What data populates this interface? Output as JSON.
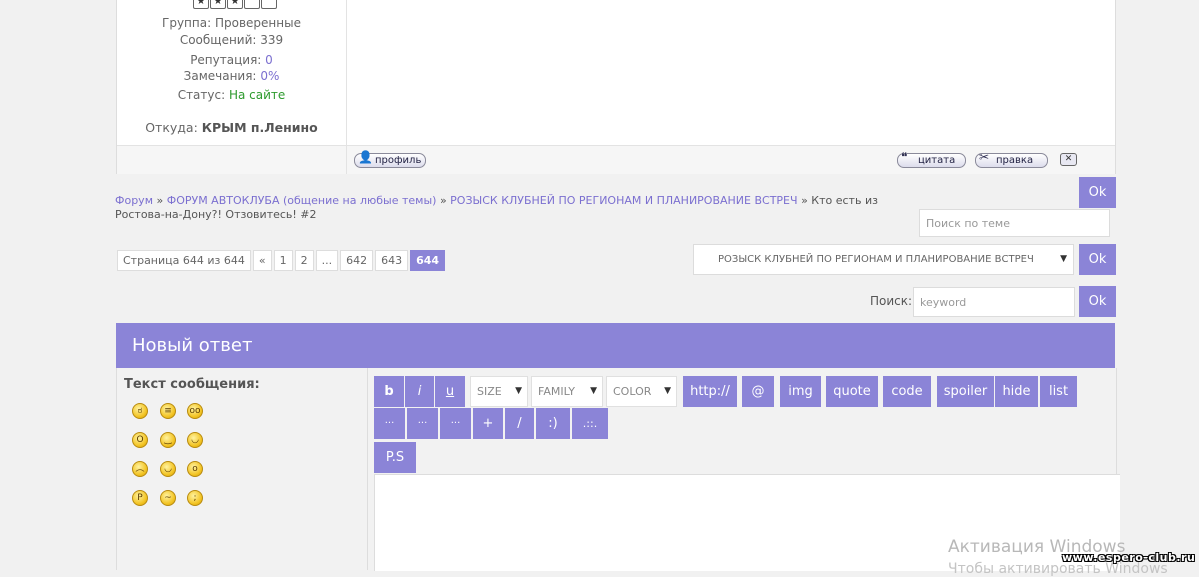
{
  "post": {
    "rating_stars": [
      "★",
      "★",
      "★",
      "",
      ""
    ],
    "group_label": "Группа:",
    "group_value": "Проверенные",
    "messages_label": "Сообщений:",
    "messages_value": "339",
    "reputation_label": "Репутация:",
    "reputation_value": "0",
    "warnings_label": "Замечания:",
    "warnings_value": "0%",
    "status_label": "Статус:",
    "status_value": "На сайте",
    "from_label": "Откуда:",
    "from_value": "КРЫМ п.Ленино",
    "profile_btn": "профиль",
    "quote_btn": "цитата",
    "edit_btn": "правка",
    "delete_btn": "✕"
  },
  "breadcrumb": {
    "items": [
      "Форум",
      "ФОРУМ АВТОКЛУБА (общение на любые темы)",
      "РОЗЫСК КЛУБНЕЙ ПО РЕГИОНАМ И ПЛАНИРОВАНИЕ ВСТРЕЧ"
    ],
    "separator": "»",
    "current": "Кто есть из Ростова-на-Дону?! Отзовитесь! #2"
  },
  "topic_search": {
    "placeholder": "Поиск по теме",
    "ok": "Ok"
  },
  "pager": {
    "label": "Страница 644 из 644",
    "pages": [
      "«",
      "1",
      "2",
      "...",
      "642",
      "643",
      "644"
    ],
    "current": "644"
  },
  "forum_select": {
    "value": "РОЗЫСК КЛУБНЕЙ ПО РЕГИОНАМ И ПЛАНИРОВАНИЕ ВСТРЕЧ",
    "ok": "Ok"
  },
  "search": {
    "label": "Поиск:",
    "placeholder": "keyword",
    "ok": "Ok"
  },
  "reply": {
    "title": "Новый ответ",
    "message_label": "Текст сообщения:",
    "toolbar_row1": [
      "b",
      "i",
      "u"
    ],
    "size_select": "SIZE",
    "family_select": "FAMILY",
    "color_select": "COLOR",
    "toolbar_row1b": [
      "http://",
      "@",
      "img",
      "quote",
      "code",
      "spoiler",
      "hide",
      "list"
    ],
    "toolbar_row2": [
      "···",
      "···",
      "···",
      "+",
      "/",
      ":)",
      ".::."
    ],
    "toolbar_row3": [
      "P.S"
    ]
  },
  "overlay": {
    "activation": "Активация Windows",
    "activation_sub": "Чтобы активировать Windows",
    "watermark": "www.espero-club.ru"
  },
  "colors": {
    "accent": "#8b84d7",
    "link": "#7b6fd0",
    "online": "#2d9a2d"
  }
}
